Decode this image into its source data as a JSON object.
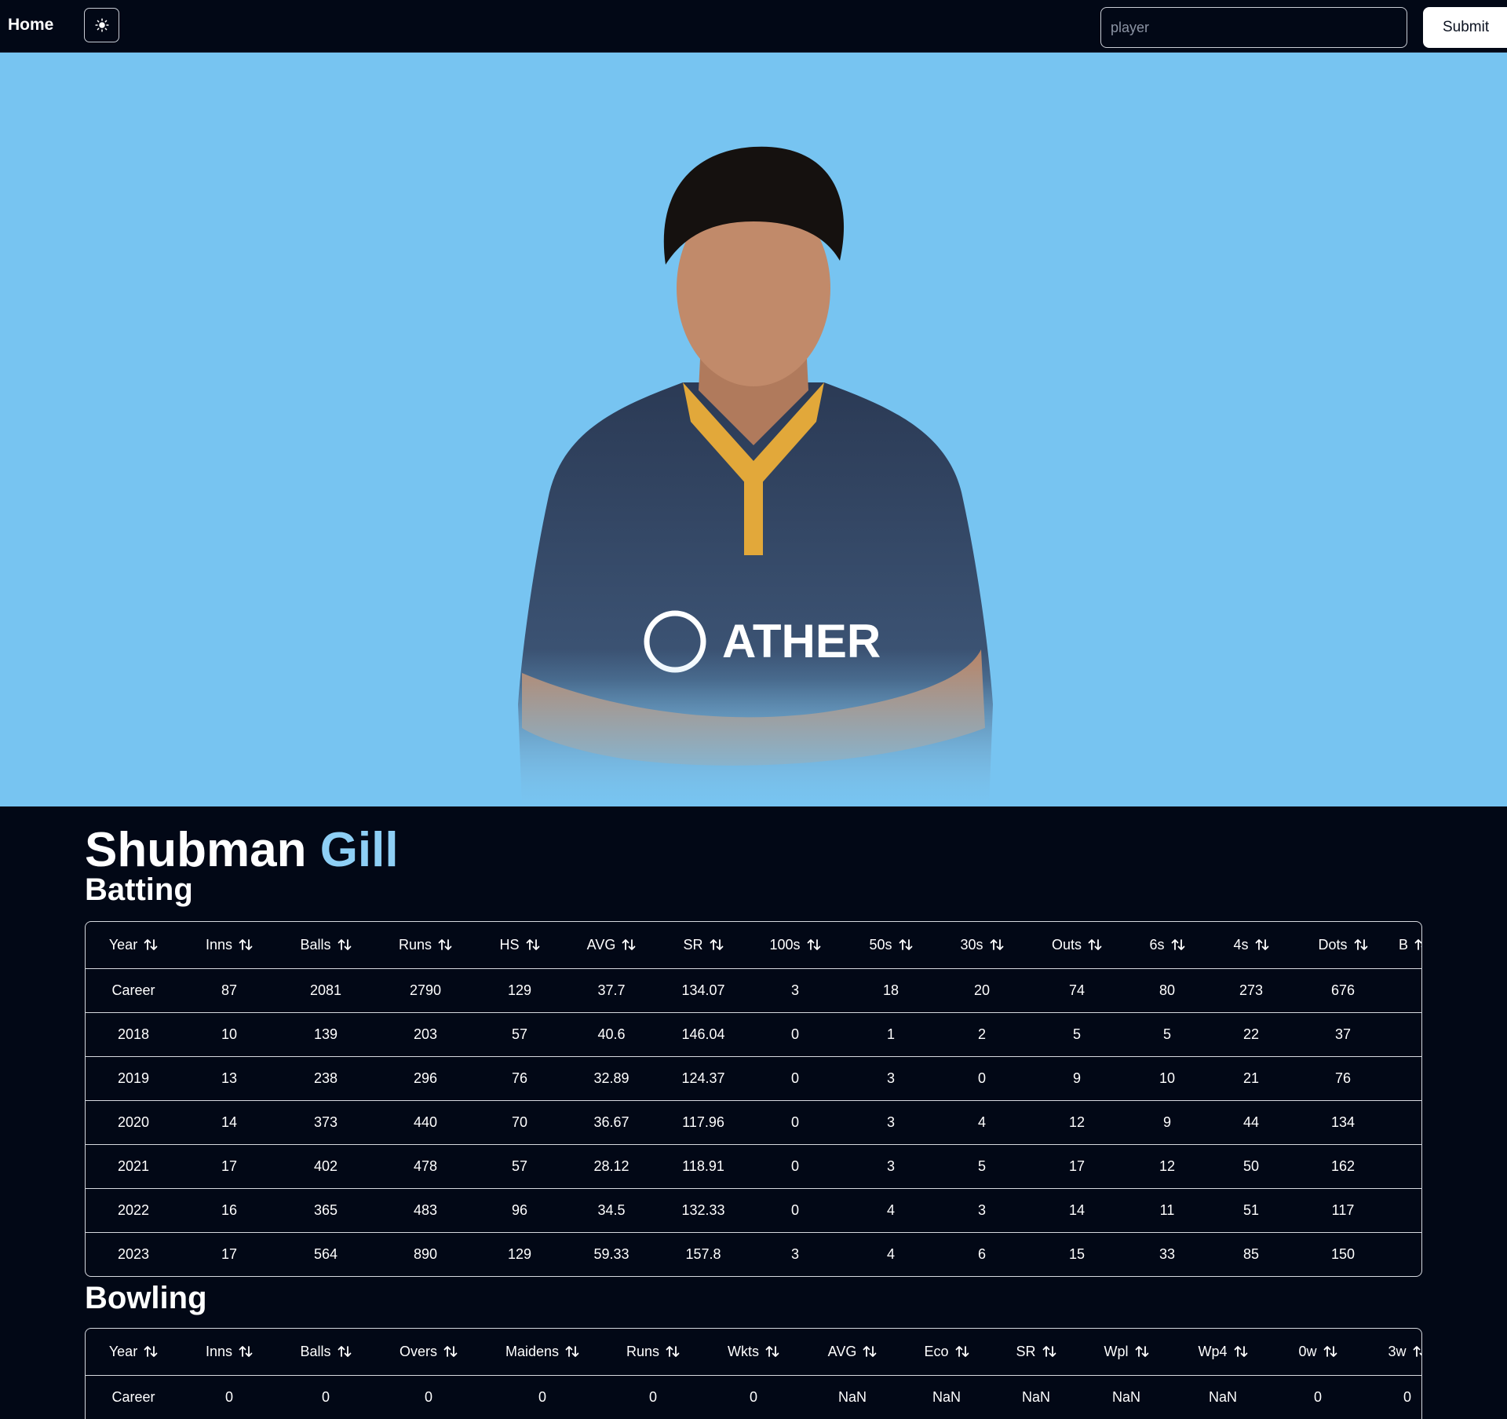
{
  "nav": {
    "home_label": "Home",
    "theme_icon": "sun-icon",
    "search_placeholder": "player",
    "search_value": "",
    "submit_label": "Submit"
  },
  "colors": {
    "background": "#020816",
    "hero_background": "#77c4f1",
    "name_accent": "#8ecff5"
  },
  "player": {
    "first_name": "Shubman",
    "last_name": "Gill"
  },
  "batting": {
    "title": "Batting",
    "columns": [
      "Year",
      "Inns",
      "Balls",
      "Runs",
      "HS",
      "AVG",
      "SR",
      "100s",
      "50s",
      "30s",
      "Outs",
      "6s",
      "4s",
      "Dots",
      "B"
    ],
    "rows": [
      [
        "Career",
        "87",
        "2081",
        "2790",
        "129",
        "37.7",
        "134.07",
        "3",
        "18",
        "20",
        "74",
        "80",
        "273",
        "676"
      ],
      [
        "2018",
        "10",
        "139",
        "203",
        "57",
        "40.6",
        "146.04",
        "0",
        "1",
        "2",
        "5",
        "5",
        "22",
        "37"
      ],
      [
        "2019",
        "13",
        "238",
        "296",
        "76",
        "32.89",
        "124.37",
        "0",
        "3",
        "0",
        "9",
        "10",
        "21",
        "76"
      ],
      [
        "2020",
        "14",
        "373",
        "440",
        "70",
        "36.67",
        "117.96",
        "0",
        "3",
        "4",
        "12",
        "9",
        "44",
        "134"
      ],
      [
        "2021",
        "17",
        "402",
        "478",
        "57",
        "28.12",
        "118.91",
        "0",
        "3",
        "5",
        "17",
        "12",
        "50",
        "162"
      ],
      [
        "2022",
        "16",
        "365",
        "483",
        "96",
        "34.5",
        "132.33",
        "0",
        "4",
        "3",
        "14",
        "11",
        "51",
        "117"
      ],
      [
        "2023",
        "17",
        "564",
        "890",
        "129",
        "59.33",
        "157.8",
        "3",
        "4",
        "6",
        "15",
        "33",
        "85",
        "150"
      ]
    ]
  },
  "bowling": {
    "title": "Bowling",
    "columns": [
      "Year",
      "Inns",
      "Balls",
      "Overs",
      "Maidens",
      "Runs",
      "Wkts",
      "AVG",
      "Eco",
      "SR",
      "Wpl",
      "Wp4",
      "0w",
      "3w"
    ],
    "rows": [
      [
        "Career",
        "0",
        "0",
        "0",
        "0",
        "0",
        "0",
        "NaN",
        "NaN",
        "NaN",
        "NaN",
        "NaN",
        "0",
        "0"
      ]
    ]
  }
}
